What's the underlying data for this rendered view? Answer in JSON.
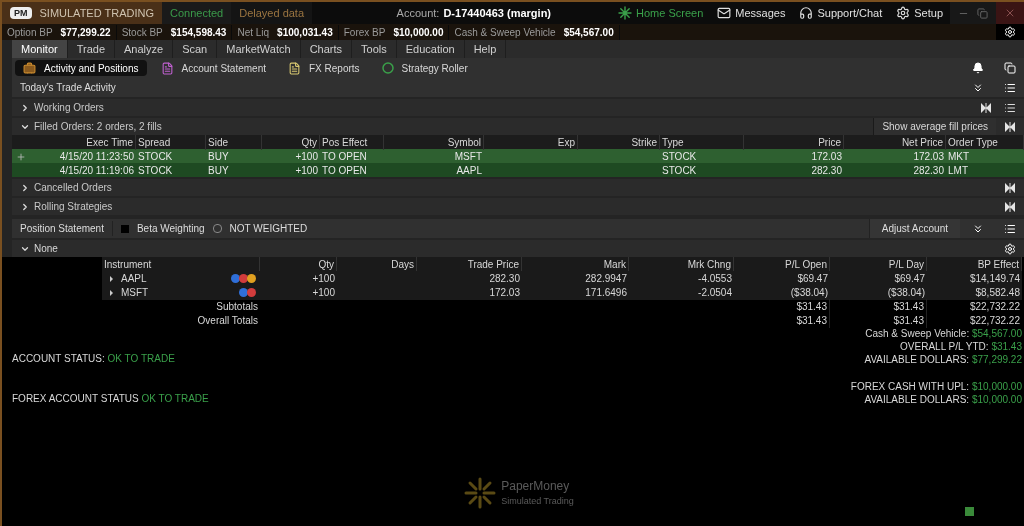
{
  "title_bar": {
    "badge": "PM",
    "mode": "SIMULATED TRADING",
    "connection": "Connected",
    "data_feed": "Delayed data",
    "account_label": "Account:",
    "account": "D-17440463 (margin)",
    "links": [
      {
        "label": "Home Screen",
        "selected": true
      },
      {
        "label": "Messages",
        "selected": false
      },
      {
        "label": "Support/Chat",
        "selected": false
      },
      {
        "label": "Setup",
        "selected": false
      }
    ]
  },
  "balances": [
    {
      "label": "Option BP",
      "value": "$77,299.22"
    },
    {
      "label": "Stock BP",
      "value": "$154,598.43"
    },
    {
      "label": "Net Liq",
      "value": "$100,031.43"
    },
    {
      "label": "Forex BP",
      "value": "$10,000.00"
    },
    {
      "label": "Cash & Sweep Vehicle",
      "value": "$54,567.00"
    }
  ],
  "tabs": [
    {
      "label": "Monitor",
      "selected": true
    },
    {
      "label": "Trade",
      "selected": false
    },
    {
      "label": "Analyze",
      "selected": false
    },
    {
      "label": "Scan",
      "selected": false
    },
    {
      "label": "MarketWatch",
      "selected": false
    },
    {
      "label": "Charts",
      "selected": false
    },
    {
      "label": "Tools",
      "selected": false
    },
    {
      "label": "Education",
      "selected": false
    },
    {
      "label": "Help",
      "selected": false
    }
  ],
  "subtabs": [
    {
      "label": "Activity and Positions",
      "selected": true
    },
    {
      "label": "Account Statement",
      "selected": false
    },
    {
      "label": "FX Reports",
      "selected": false
    },
    {
      "label": "Strategy Roller",
      "selected": false
    }
  ],
  "panel_title": "Today's Trade Activity",
  "order_sections": [
    {
      "title": "Working Orders",
      "expanded": false
    },
    {
      "title": "Filled Orders: 2 orders, 2 fills",
      "expanded": true,
      "action": "Show average fill prices",
      "columns": [
        "Exec Time",
        "Spread",
        "Side",
        "Qty",
        "Pos Effect",
        "Symbol",
        "Exp",
        "Strike",
        "Type",
        "Price",
        "Net Price",
        "Order Type"
      ],
      "rows": [
        {
          "selected": true,
          "exec_time": "4/15/20 11:23:50",
          "spread": "STOCK",
          "side": "BUY",
          "qty": "+100",
          "pos_effect": "TO OPEN",
          "symbol": "MSFT",
          "type": "STOCK",
          "price": "172.03",
          "net_price": "172.03",
          "order_type": "MKT"
        },
        {
          "selected": false,
          "exec_time": "4/15/20 11:19:06",
          "spread": "STOCK",
          "side": "BUY",
          "qty": "+100",
          "pos_effect": "TO OPEN",
          "symbol": "AAPL",
          "type": "STOCK",
          "price": "282.30",
          "net_price": "282.30",
          "order_type": "LMT"
        }
      ]
    },
    {
      "title": "Cancelled Orders",
      "expanded": false
    },
    {
      "title": "Rolling Strategies",
      "expanded": false
    }
  ],
  "position_statement": {
    "title": "Position Statement",
    "beta_weighting": {
      "label": "Beta Weighting",
      "checked": false
    },
    "weighting": "NOT WEIGHTED",
    "adjust": "Adjust Account"
  },
  "positions": {
    "group": "None",
    "expanded": true,
    "columns": [
      "Instrument",
      "Qty",
      "Days",
      "Trade Price",
      "Mark",
      "Mrk Chng",
      "P/L Open",
      "P/L Day",
      "BP Effect"
    ],
    "rows": [
      {
        "symbol": "AAPL",
        "badges": [
          {
            "color": "#2f6fd8"
          },
          {
            "color": "#d23c3c"
          },
          {
            "color": "#e0a020"
          }
        ],
        "qty": "+100",
        "trade_price": "282.30",
        "mark": "282.9947",
        "mrk_chng": "-4.0553",
        "pl_open": "$69.47",
        "pl_day": "$69.47",
        "bp_effect": "$14,149.74"
      },
      {
        "symbol": "MSFT",
        "badges": [
          {
            "color": "#2f6fd8"
          },
          {
            "color": "#d23c3c"
          }
        ],
        "qty": "+100",
        "trade_price": "172.03",
        "mark": "171.6496",
        "mrk_chng": "-2.0504",
        "pl_open": "($38.04)",
        "pl_day": "($38.04)",
        "bp_effect": "$8,582.48"
      }
    ],
    "totals": [
      {
        "label": "Subtotals",
        "pl_open": "$31.43",
        "pl_day": "$31.43",
        "bp_effect": "$22,732.22"
      },
      {
        "label": "Overall Totals",
        "pl_open": "$31.43",
        "pl_day": "$31.43",
        "bp_effect": "$22,732.22"
      }
    ]
  },
  "summary": [
    {
      "status": {
        "label": "ACCOUNT STATUS:",
        "value": "OK TO TRADE"
      },
      "lines": [
        {
          "label": "Cash & Sweep Vehicle:",
          "value": "$54,567.00"
        },
        {
          "label": "OVERALL P/L YTD:",
          "value": "$31.43"
        },
        {
          "label": "AVAILABLE DOLLARS:",
          "value": "$77,299.22"
        }
      ]
    },
    {
      "status": {
        "label": "FOREX ACCOUNT STATUS",
        "value": "OK TO TRADE"
      },
      "lines": [
        {
          "label": "FOREX CASH WITH UPL:",
          "value": "$10,000.00"
        },
        {
          "label": "AVAILABLE DOLLARS:",
          "value": "$10,000.00"
        }
      ]
    }
  ],
  "footer_logo": {
    "product": "PaperMoney",
    "subtitle": "Simulated Trading"
  }
}
